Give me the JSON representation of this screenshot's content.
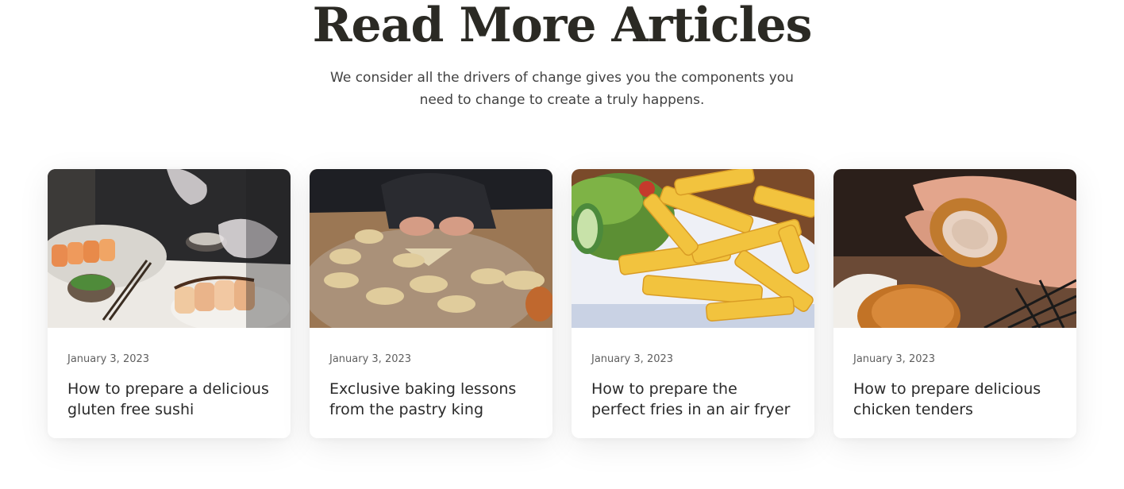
{
  "section": {
    "title": "Read More Articles",
    "subtitle": "We consider all the drivers of change gives you the components you need to change to create a truly happens."
  },
  "articles": [
    {
      "date": "January 3, 2023",
      "title": "How to prepare a delicious gluten free sushi",
      "image": "sushi-photo"
    },
    {
      "date": "January 3, 2023",
      "title": "Exclusive baking lessons from the pastry king",
      "image": "croissant-dough-photo"
    },
    {
      "date": "January 3, 2023",
      "title": "How to prepare the perfect fries in an air fryer",
      "image": "fries-salad-photo"
    },
    {
      "date": "January 3, 2023",
      "title": "How to prepare delicious chicken tenders",
      "image": "chicken-tenders-photo"
    }
  ]
}
